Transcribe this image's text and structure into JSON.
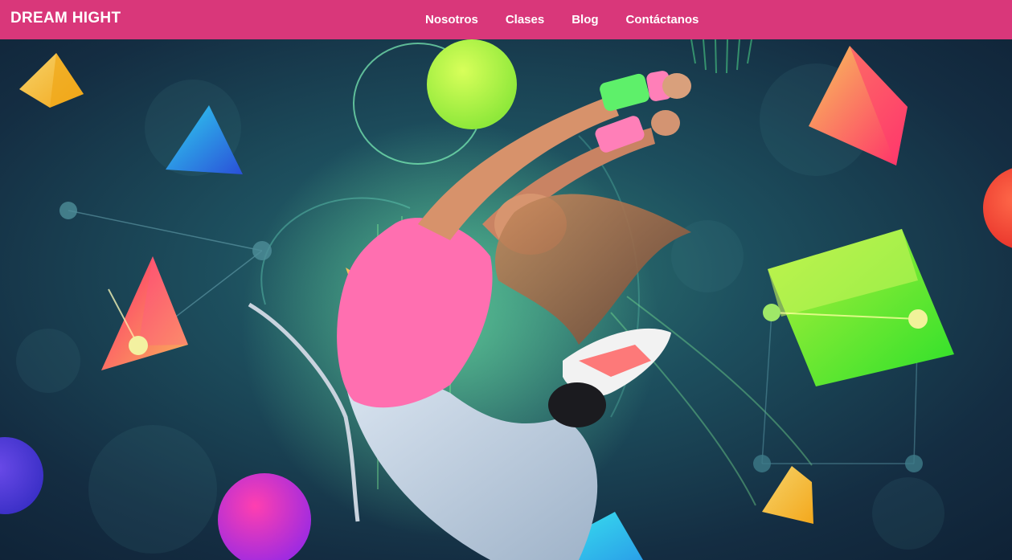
{
  "colors": {
    "navbar": "#d9377a",
    "hero_background": "#13303f",
    "hero_glow": "#2f8a7a"
  },
  "navbar": {
    "brand": "DREAM HIGHT",
    "links": [
      {
        "label": "Nosotros"
      },
      {
        "label": "Clases"
      },
      {
        "label": "Blog"
      },
      {
        "label": "Contáctanos"
      }
    ]
  },
  "hero": {
    "image_description_icon": "dancer-hero-image"
  }
}
